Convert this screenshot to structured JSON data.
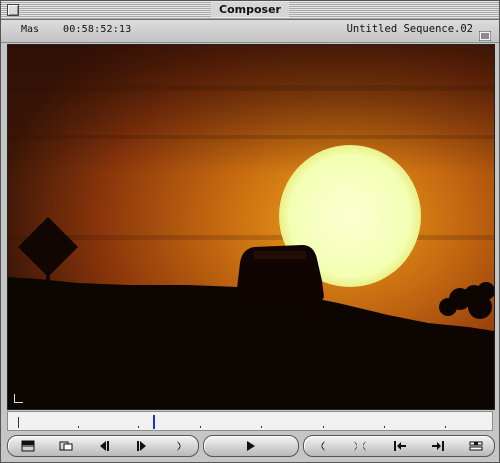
{
  "window": {
    "title": "Composer"
  },
  "info": {
    "mode": "Mas",
    "timecode": "00:58:52:13",
    "sequence": "Untitled Sequence.02"
  },
  "timeline": {
    "playhead_fraction": 0.3
  },
  "controls": {
    "left_group": [
      "track-selector-icon",
      "monitor-toggle-icon",
      "step-back-icon",
      "step-forward-icon",
      "mark-out-icon"
    ],
    "center_group": [
      "play-icon"
    ],
    "right_group": [
      "mark-in-icon",
      "mark-clip-icon",
      "go-to-in-icon",
      "go-to-out-icon",
      "match-frame-icon"
    ]
  },
  "colors": {
    "sky_top": "#3a1706",
    "sky_mid": "#a8470f",
    "sky_glow": "#d9780f",
    "sun": "#f7ffc2",
    "playhead": "#1b2fd3"
  }
}
